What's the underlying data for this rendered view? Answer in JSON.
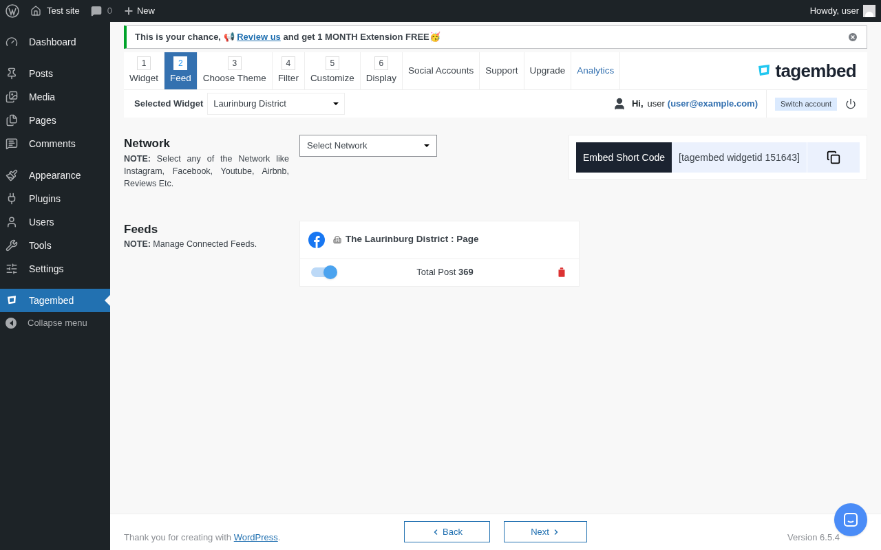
{
  "admin_bar": {
    "site": "Test site",
    "comments": "0",
    "new": "New",
    "greeting": "Howdy, user"
  },
  "sidebar": {
    "groups": [
      {
        "items": [
          {
            "label": "Dashboard",
            "selected": false
          }
        ]
      },
      {
        "items": [
          {
            "label": "Posts",
            "selected": false
          },
          {
            "label": "Media",
            "selected": false
          },
          {
            "label": "Pages",
            "selected": false
          },
          {
            "label": "Comments",
            "selected": false
          }
        ]
      },
      {
        "items": [
          {
            "label": "Appearance",
            "selected": false
          },
          {
            "label": "Plugins",
            "selected": false
          },
          {
            "label": "Users",
            "selected": false
          },
          {
            "label": "Tools",
            "selected": false
          },
          {
            "label": "Settings",
            "selected": false
          }
        ]
      },
      {
        "items": [
          {
            "label": "Tagembed",
            "selected": true
          }
        ]
      }
    ],
    "collapse": "Collapse menu"
  },
  "notice": {
    "text": "This is your chance, 📢 ",
    "link": "Review us",
    "after": " and get 1 MONTH Extension FREE🥳"
  },
  "tabs": [
    {
      "kind": "step",
      "number": "1",
      "label": "Widget",
      "selected": false
    },
    {
      "kind": "step",
      "number": "2",
      "label": "Feed",
      "selected": true
    },
    {
      "kind": "step",
      "number": "3",
      "label": "Choose Theme",
      "selected": false
    },
    {
      "kind": "step",
      "number": "4",
      "label": "Filter",
      "selected": false
    },
    {
      "kind": "step",
      "number": "5",
      "label": "Customize",
      "selected": false
    },
    {
      "kind": "step",
      "number": "6",
      "label": "Display",
      "selected": false
    },
    {
      "kind": "link",
      "label": "Social Accounts",
      "selected": false
    },
    {
      "kind": "link",
      "label": "Support",
      "selected": false
    },
    {
      "kind": "link",
      "label": "Upgrade",
      "selected": false
    },
    {
      "kind": "accent",
      "label": "Analytics",
      "selected": false
    }
  ],
  "logo": "tagembed",
  "widget_bar": {
    "label": "Selected Widget",
    "value": "Laurinburg District",
    "hi": "Hi,",
    "user": "user",
    "email": "(user@example.com)",
    "switch": "Switch account"
  },
  "network": {
    "title": "Network",
    "note_label": "NOTE:",
    "note": " Select any of the Network like Instagram, Facebook, Youtube, Airbnb, Reviews Etc.",
    "select": "Select Network"
  },
  "embed": {
    "label": "Embed Short Code",
    "code": "[tagembed widgetid 151643]"
  },
  "feeds": {
    "title": "Feeds",
    "note_label": "NOTE:",
    "note": " Manage Connected Feeds.",
    "items": [
      {
        "name": "The Laurinburg District : Page",
        "on": true,
        "total_label": "Total Post ",
        "total": "369"
      }
    ]
  },
  "footer": {
    "thanks": "Thank you for creating with ",
    "link": "WordPress",
    "period": ".",
    "back": "Back",
    "next": "Next",
    "version": "Version 6.5.4"
  }
}
